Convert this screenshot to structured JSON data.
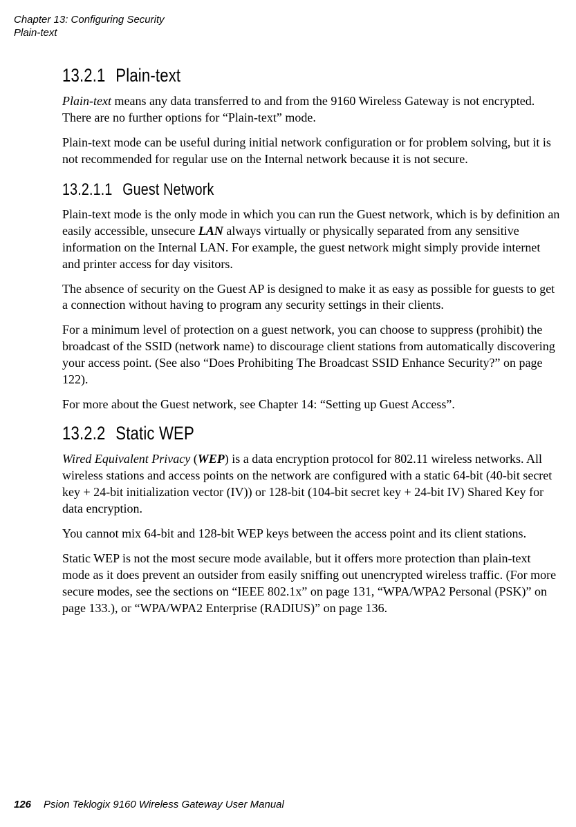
{
  "header": {
    "chapter": "Chapter 13:  Configuring Security",
    "section": "Plain-text"
  },
  "s1": {
    "num": "13.2.1",
    "title": "Plain-text",
    "p1a": "Plain-text",
    "p1b": " means any data transferred to and from the 9160 Wireless Gateway is not encrypted. There are no further options for “Plain-text” mode.",
    "p2": "Plain-text mode can be useful during initial network configuration or for problem solving, but it is not recommended for regular use on the Internal network because it is not secure."
  },
  "s1_1": {
    "num": "13.2.1.1",
    "title": "Guest Network",
    "p1a": "Plain-text mode is the only mode in which you can run the Guest network, which is by definition an easily accessible, unsecure ",
    "p1b": "LAN",
    "p1c": " always virtually or physically separated from any sensitive information on the Internal LAN. For example, the guest network might simply provide internet and printer access for day visitors.",
    "p2": "The absence of security on the Guest AP is designed to make it as easy as possible for guests to get a connection without having to program any security settings in their clients.",
    "p3": "For a minimum level of protection on a guest network, you can choose to suppress (prohibit) the broadcast of the SSID (network name) to discourage client stations from automatically discovering your access point. (See also “Does Prohibiting The Broadcast SSID Enhance Security?” on page 122).",
    "p4": "For more about the Guest network, see Chapter 14: “Setting up Guest Access”."
  },
  "s2": {
    "num": "13.2.2",
    "title": "Static WEP",
    "p1a": "Wired Equivalent Privacy",
    "p1b": " (",
    "p1c": "WEP",
    "p1d": ") is a data encryption protocol for 802.11 wireless networks. All wireless stations and access points on the network are configured with a static 64-bit (40-bit secret key + 24-bit initialization vector (IV)) or 128-bit (104-bit secret key + 24-bit IV) Shared Key for data encryption.",
    "p2": "You cannot mix 64-bit and 128-bit WEP keys between the access point and its client stations.",
    "p3": "Static WEP is not the most secure mode available, but it offers more protection than plain-text mode as it does prevent an outsider from easily sniffing out unencrypted wireless traffic. (For more secure modes, see the sections on “IEEE 802.1x” on page 131, “WPA/WPA2 Personal (PSK)” on page 133.), or “WPA/WPA2 Enterprise (RADIUS)” on page 136."
  },
  "footer": {
    "page": "126",
    "title": "Psion Teklogix 9160 Wireless Gateway User Manual"
  }
}
